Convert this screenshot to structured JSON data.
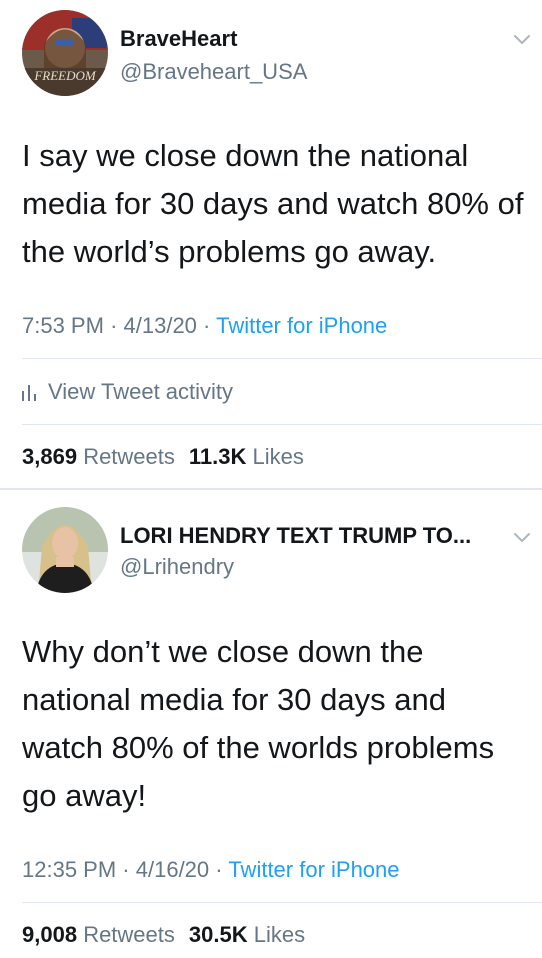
{
  "tweets": [
    {
      "display_name": "BraveHeart",
      "handle": "@Braveheart_USA",
      "avatar_caption": "FREEDOM",
      "text": "I say we close down the national media for 30 days and watch 80% of the world’s problems go away.",
      "time": "7:53 PM",
      "date": "4/13/20",
      "separator": "·",
      "source": "Twitter for iPhone",
      "activity_label": "View Tweet activity",
      "retweets_count": "3,869",
      "retweets_label": "Retweets",
      "likes_count": "11.3K",
      "likes_label": "Likes"
    },
    {
      "display_name": "LORI HENDRY TEXT TRUMP TO...",
      "handle": "@Lrihendry",
      "text": "Why don’t we close down the national media for 30 days and watch 80% of the worlds problems go away!",
      "time": "12:35 PM",
      "date": "4/16/20",
      "separator": "·",
      "source": "Twitter for iPhone",
      "retweets_count": "9,008",
      "retweets_label": "Retweets",
      "likes_count": "30.5K",
      "likes_label": "Likes"
    }
  ],
  "icons": {
    "menu": "chevron-down-icon",
    "activity": "bar-chart-icon"
  },
  "colors": {
    "link": "#1da1f2",
    "secondary_text": "#657786",
    "primary_text": "#14171a",
    "divider": "#e1e8ed"
  }
}
